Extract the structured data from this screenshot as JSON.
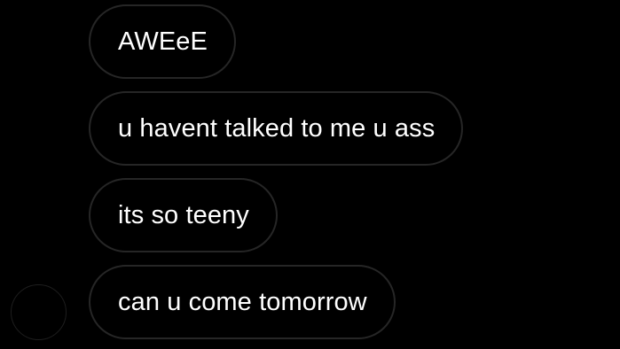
{
  "conversation": {
    "messages": [
      {
        "text": "AWEeE"
      },
      {
        "text": "u havent talked to me u ass"
      },
      {
        "text": "its so teeny"
      },
      {
        "text": "can u come tomorrow"
      }
    ]
  },
  "colors": {
    "background": "#000000",
    "bubble_border": "#262626",
    "text": "#ffffff"
  },
  "icons": {
    "avatar": "sender-avatar"
  }
}
